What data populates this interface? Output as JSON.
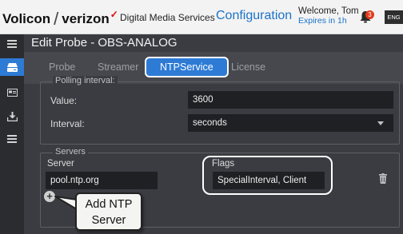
{
  "header": {
    "logo_volicon": "Volicon",
    "logo_slash": "/",
    "logo_verizon": "verizon",
    "logo_check": "✓",
    "product": "Digital Media Services",
    "section": "Configuration",
    "welcome": "Welcome, Tom",
    "expires": "Expires in 1h",
    "notification_count": "3",
    "language": "ENG"
  },
  "sidebar": {
    "items": [
      {
        "icon": "menu-icon",
        "active": false
      },
      {
        "icon": "probe-icon",
        "active": true
      },
      {
        "icon": "card-icon",
        "active": false
      },
      {
        "icon": "download-icon",
        "active": false
      },
      {
        "icon": "list-icon",
        "active": false
      }
    ]
  },
  "page": {
    "title": "Edit Probe - OBS-ANALOG"
  },
  "tabs": [
    {
      "label": "Probe",
      "active": false
    },
    {
      "label": "Streamer",
      "active": false
    },
    {
      "label": "NTPService",
      "active": true
    },
    {
      "label": "License",
      "active": false
    }
  ],
  "polling": {
    "legend": "Polling interval:",
    "value_label": "Value:",
    "value": "3600",
    "interval_label": "Interval:",
    "interval_value": "seconds"
  },
  "servers": {
    "legend": "Servers",
    "server_col": "Server",
    "flags_col": "Flags",
    "rows": [
      {
        "server": "pool.ntp.org",
        "flags": "SpecialInterval, Client"
      }
    ],
    "add_icon": "plus-circle-icon",
    "delete_icon": "trash-icon"
  },
  "callout": {
    "line1": "Add NTP",
    "line2": "Server"
  },
  "colors": {
    "accent": "#2e7bd6",
    "brand_red": "#e00000",
    "content_bg": "#3a3c41",
    "sidebar_bg": "#2a2c30"
  }
}
